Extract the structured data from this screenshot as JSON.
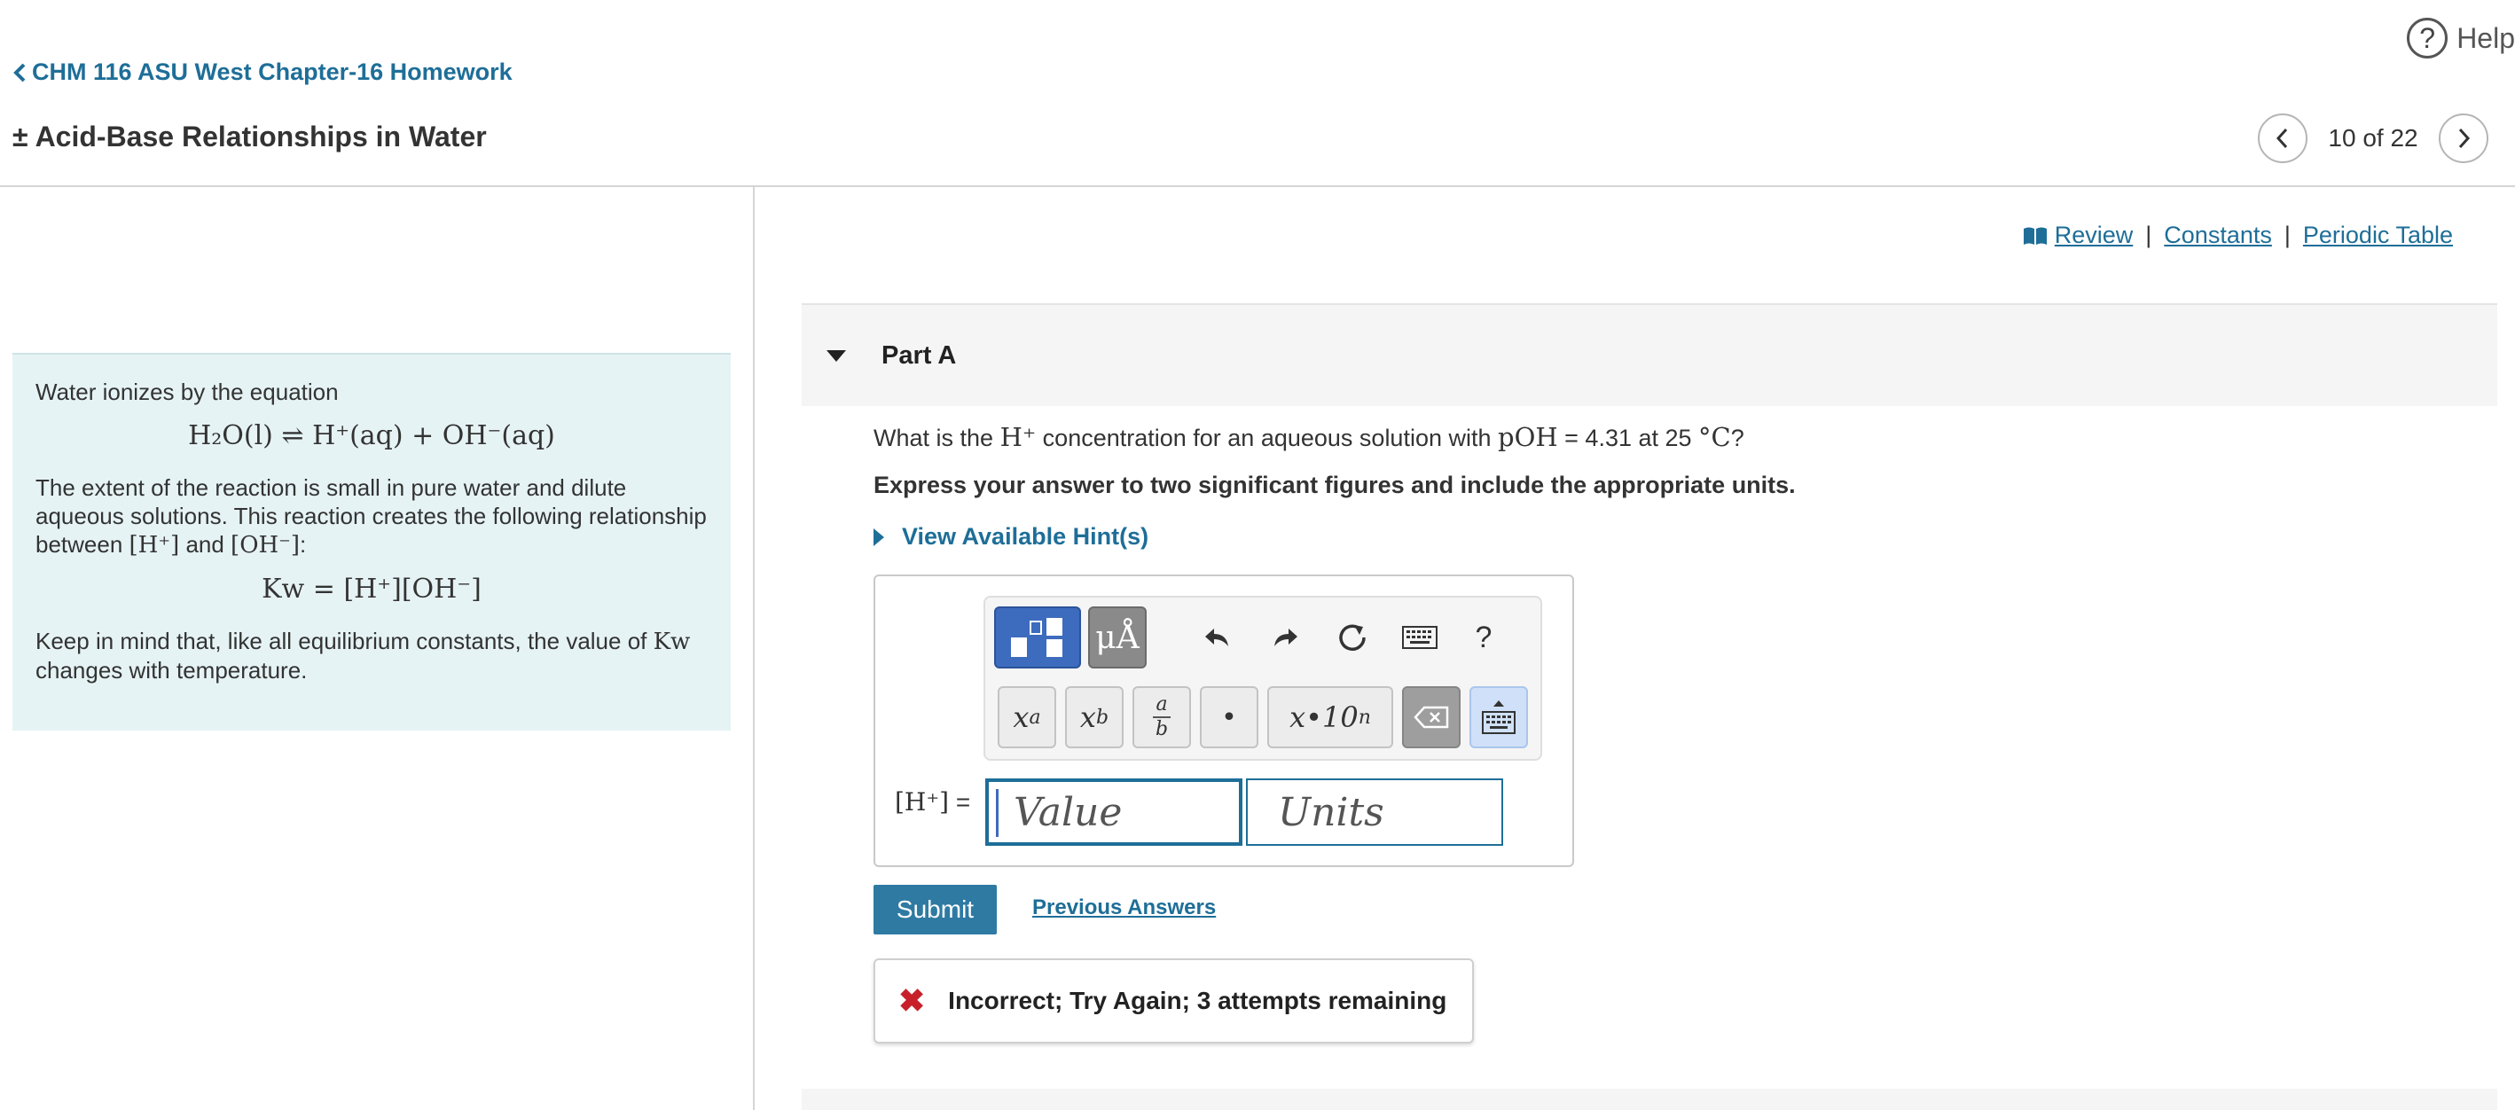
{
  "header": {
    "help_label": "Help",
    "help_symbol": "?",
    "back_link": "CHM 116 ASU West Chapter-16 Homework",
    "title_prefix": "±",
    "title": "Acid-Base Relationships in Water",
    "pager": "10 of 22"
  },
  "intro": {
    "line1": "Water ionizes by the equation",
    "equation": "H₂O(l) ⇌ H⁺(aq) + OH⁻(aq)",
    "para2_a": "The extent of the reaction is small in pure water and dilute aqueous solutions. This reaction creates the following relationship between ",
    "h_conc": "[H⁺]",
    "and": " and ",
    "oh_conc": "[OH⁻]",
    "colon": ":",
    "kw_equation": "Kw = [H⁺][OH⁻]",
    "para3_a": "Keep in mind that, like all equilibrium constants, the value of ",
    "kw": "Kw",
    "para3_b": " changes with temperature."
  },
  "links": {
    "review": "Review",
    "constants": "Constants",
    "periodic_table": "Periodic Table",
    "separator": "|"
  },
  "part": {
    "title": "Part A",
    "question_a": "What is the ",
    "question_h": "H⁺",
    "question_b": " concentration for an aqueous solution with ",
    "question_poh": "pOH",
    "question_c": " = 4.31 at 25 ",
    "question_deg": "°C",
    "question_d": "?",
    "instruction": "Express your answer to two significant figures and include the appropriate units.",
    "hint": "View Available Hint(s)"
  },
  "answer": {
    "toolbar": {
      "mu_label": "μÅ",
      "help": "?",
      "key_exp": "x",
      "key_exp_sup": "a",
      "key_sub": "x",
      "key_sub_sub": "b",
      "key_frac_num": "a",
      "key_frac_den": "b",
      "key_dot": "•",
      "key_sci": "x•10",
      "key_sci_sup": "n"
    },
    "label": "[H⁺]",
    "label_eq": " =",
    "value_placeholder": "Value",
    "units_placeholder": "Units"
  },
  "actions": {
    "submit": "Submit",
    "previous_answers": "Previous Answers"
  },
  "feedback": {
    "icon": "✖",
    "message": "Incorrect; Try Again; 3 attempts remaining"
  },
  "colors": {
    "link": "#1e6e98",
    "submit": "#2e7aa3",
    "error": "#c8202b",
    "intro_bg": "#e6f3f5"
  }
}
